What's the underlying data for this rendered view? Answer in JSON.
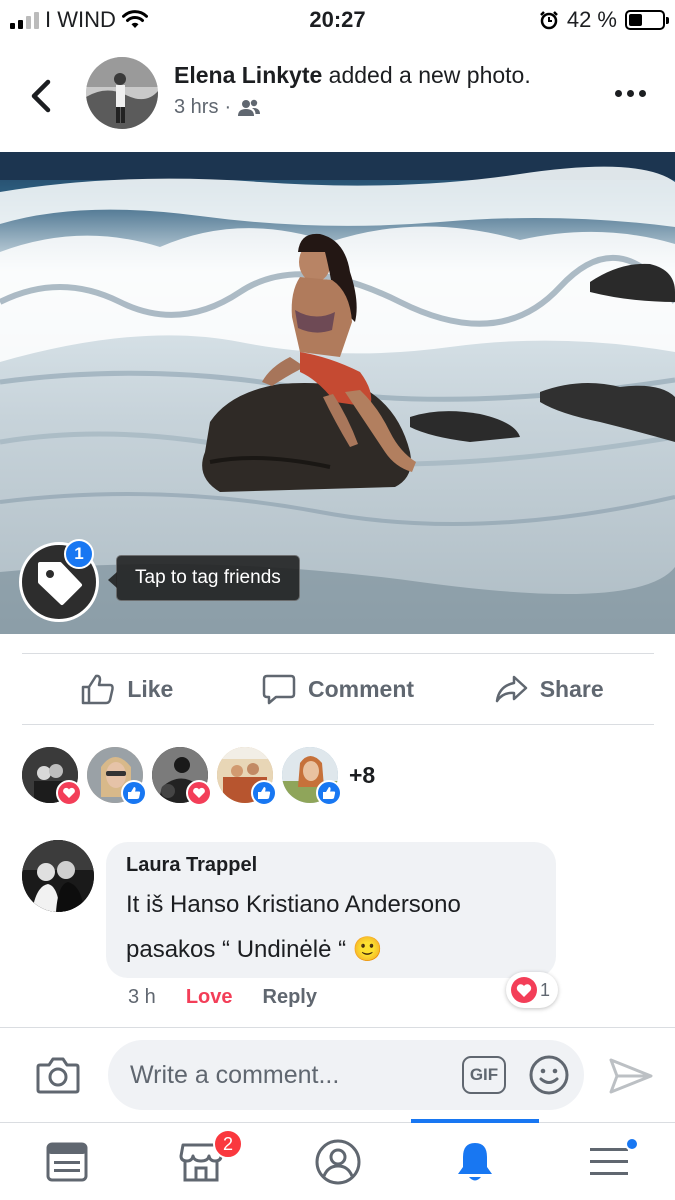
{
  "status_bar": {
    "carrier": "I WIND",
    "time": "20:27",
    "battery_text": "42 %",
    "battery_level": 0.42
  },
  "post": {
    "author": "Elena Linkyte",
    "action_text": "added a new photo.",
    "time_ago": "3 hrs",
    "audience_icon": "friends-icon",
    "more_icon": "more-icon"
  },
  "photo": {
    "tag_badge_count": "1",
    "tag_tooltip": "Tap to tag friends"
  },
  "actions": {
    "like": "Like",
    "comment": "Comment",
    "share": "Share"
  },
  "reactions": {
    "faces": [
      {
        "reaction": "love"
      },
      {
        "reaction": "like"
      },
      {
        "reaction": "love"
      },
      {
        "reaction": "like"
      },
      {
        "reaction": "like"
      }
    ],
    "more_count": "+8"
  },
  "comment": {
    "author": "Laura Trappel",
    "text_line1": "It iš Hanso Kristiano Andersono",
    "text_line2": "pasakos “ Undinėlė “",
    "emoji": "🙂",
    "time": "3 h",
    "love_label": "Love",
    "reply_label": "Reply",
    "reaction_count": "1"
  },
  "composer": {
    "placeholder": "Write a comment...",
    "gif_label": "GIF"
  },
  "tab_bar": {
    "marketplace_badge": "2"
  },
  "colors": {
    "facebook_blue": "#1877f2",
    "love_red": "#f33e58",
    "badge_red": "#fa383e",
    "secondary_text": "#606770",
    "bubble_bg": "#f0f2f5"
  }
}
